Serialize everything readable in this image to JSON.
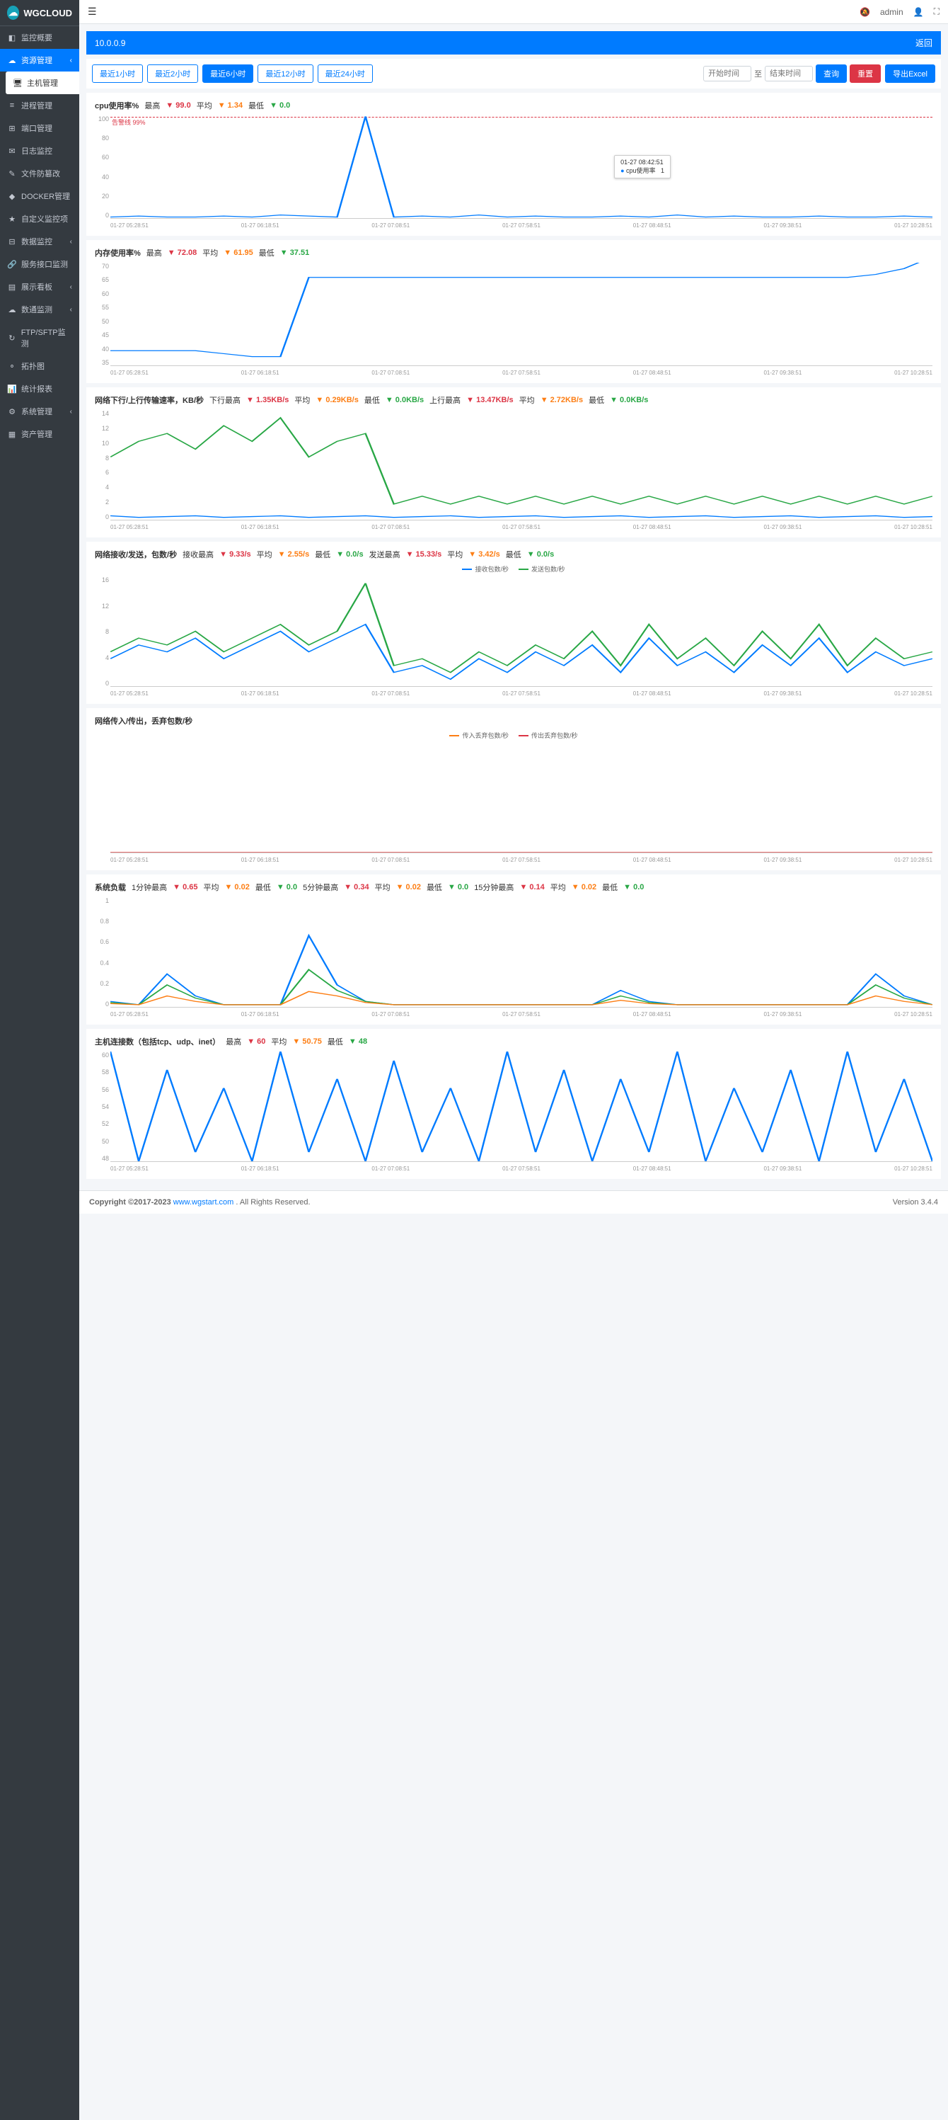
{
  "app": {
    "name": "WGCLOUD"
  },
  "topbar": {
    "user": "admin"
  },
  "sidebar": {
    "items": [
      {
        "icon": "dashboard",
        "label": "监控概要"
      },
      {
        "icon": "cloud",
        "label": "资源管理",
        "active": true,
        "expand": true
      },
      {
        "icon": "desktop",
        "label": "主机管理",
        "sub": true
      },
      {
        "icon": "process",
        "label": "进程管理"
      },
      {
        "icon": "port",
        "label": "端口管理"
      },
      {
        "icon": "log",
        "label": "日志监控"
      },
      {
        "icon": "file",
        "label": "文件防篡改"
      },
      {
        "icon": "docker",
        "label": "DOCKER管理"
      },
      {
        "icon": "star",
        "label": "自定义监控项"
      },
      {
        "icon": "db",
        "label": "数据监控",
        "expand": true
      },
      {
        "icon": "api",
        "label": "服务接口监测"
      },
      {
        "icon": "board",
        "label": "展示看板",
        "expand": true
      },
      {
        "icon": "cloud2",
        "label": "数通监测",
        "expand": true
      },
      {
        "icon": "ftp",
        "label": "FTP/SFTP监测"
      },
      {
        "icon": "topo",
        "label": "拓扑图"
      },
      {
        "icon": "report",
        "label": "统计报表"
      },
      {
        "icon": "sys",
        "label": "系统管理",
        "expand": true
      },
      {
        "icon": "asset",
        "label": "资产管理"
      }
    ]
  },
  "host": {
    "ip": "10.0.0.9",
    "back": "返回"
  },
  "toolbar": {
    "ranges": [
      "最近1小时",
      "最近2小时",
      "最近6小时",
      "最近12小时",
      "最近24小时"
    ],
    "activeRange": 2,
    "startPlaceholder": "开始时间",
    "to": "至",
    "endPlaceholder": "结束时间",
    "query": "查询",
    "reset": "重置",
    "export": "导出Excel"
  },
  "charts": [
    {
      "title": "cpu使用率%",
      "stats": [
        {
          "l": "最高",
          "v": "99.0",
          "c": "red"
        },
        {
          "l": "平均",
          "v": "1.34",
          "c": "orange"
        },
        {
          "l": "最低",
          "v": "0.0",
          "c": "green"
        }
      ],
      "warn": "告警线 99%",
      "tooltip": {
        "time": "01-27 08:42:51",
        "name": "cpu使用率",
        "val": "1"
      },
      "chart_data": {
        "type": "line",
        "ylim": [
          0,
          100
        ],
        "yticks": [
          0,
          20,
          40,
          60,
          80,
          100
        ],
        "x_labels": [
          "01-27 05:28:51",
          "01-27 06:18:51",
          "01-27 07:08:51",
          "01-27 07:58:51",
          "01-27 08:48:51",
          "01-27 09:38:51",
          "01-27 10:28:51"
        ],
        "series": [
          {
            "name": "cpu使用率",
            "color": "#007bff",
            "values": [
              1,
              2,
              1,
              1,
              2,
              1,
              3,
              2,
              1,
              99,
              1,
              2,
              1,
              3,
              1,
              2,
              1,
              1,
              2,
              1,
              3,
              1,
              2,
              1,
              1,
              2,
              1,
              1,
              2,
              1
            ]
          }
        ]
      }
    },
    {
      "title": "内存使用率%",
      "stats": [
        {
          "l": "最高",
          "v": "72.08",
          "c": "red"
        },
        {
          "l": "平均",
          "v": "61.95",
          "c": "orange"
        },
        {
          "l": "最低",
          "v": "37.51",
          "c": "green"
        }
      ],
      "chart_data": {
        "type": "line",
        "ylim": [
          35,
          70
        ],
        "yticks": [
          35,
          40,
          45,
          50,
          55,
          60,
          65,
          70
        ],
        "x_labels": [
          "01-27 05:28:51",
          "01-27 06:18:51",
          "01-27 07:08:51",
          "01-27 07:58:51",
          "01-27 08:48:51",
          "01-27 09:38:51",
          "01-27 10:28:51"
        ],
        "series": [
          {
            "name": "内存使用率",
            "color": "#007bff",
            "values": [
              40,
              40,
              40,
              40,
              39,
              38,
              38,
              65,
              65,
              65,
              65,
              65,
              65,
              65,
              65,
              65,
              65,
              65,
              65,
              65,
              65,
              65,
              65,
              65,
              65,
              65,
              65,
              66,
              68,
              72
            ]
          }
        ]
      }
    },
    {
      "title": "网络下行/上行传输速率，KB/秒",
      "stats": [
        {
          "l": "下行最高",
          "v": "1.35KB/s",
          "c": "red"
        },
        {
          "l": "平均",
          "v": "0.29KB/s",
          "c": "orange"
        },
        {
          "l": "最低",
          "v": "0.0KB/s",
          "c": "green"
        },
        {
          "l": "上行最高",
          "v": "13.47KB/s",
          "c": "red"
        },
        {
          "l": "平均",
          "v": "2.72KB/s",
          "c": "orange"
        },
        {
          "l": "最低",
          "v": "0.0KB/s",
          "c": "green"
        }
      ],
      "chart_data": {
        "type": "line",
        "ylim": [
          0,
          14
        ],
        "yticks": [
          0,
          2,
          4,
          6,
          8,
          10,
          12,
          14
        ],
        "x_labels": [
          "01-27 05:28:51",
          "01-27 06:18:51",
          "01-27 07:08:51",
          "01-27 07:58:51",
          "01-27 08:48:51",
          "01-27 09:38:51",
          "01-27 10:28:51"
        ],
        "series": [
          {
            "name": "下行",
            "color": "#007bff",
            "values": [
              0.5,
              0.3,
              0.4,
              0.5,
              0.3,
              0.4,
              0.5,
              0.3,
              0.4,
              0.5,
              0.3,
              0.4,
              0.5,
              0.3,
              0.4,
              0.5,
              0.3,
              0.4,
              0.5,
              0.3,
              0.4,
              0.5,
              0.3,
              0.4,
              0.5,
              0.3,
              0.4,
              0.5,
              0.3,
              0.4
            ]
          },
          {
            "name": "上行",
            "color": "#28a745",
            "values": [
              8,
              10,
              11,
              9,
              12,
              10,
              13,
              8,
              10,
              11,
              2,
              3,
              2,
              3,
              2,
              3,
              2,
              3,
              2,
              3,
              2,
              3,
              2,
              3,
              2,
              3,
              2,
              3,
              2,
              3
            ]
          }
        ]
      }
    },
    {
      "title": "网络接收/发送，包数/秒",
      "stats": [
        {
          "l": "接收最高",
          "v": "9.33/s",
          "c": "red"
        },
        {
          "l": "平均",
          "v": "2.55/s",
          "c": "orange"
        },
        {
          "l": "最低",
          "v": "0.0/s",
          "c": "green"
        },
        {
          "l": "发送最高",
          "v": "15.33/s",
          "c": "red"
        },
        {
          "l": "平均",
          "v": "3.42/s",
          "c": "orange"
        },
        {
          "l": "最低",
          "v": "0.0/s",
          "c": "green"
        }
      ],
      "legend": [
        {
          "name": "接收包数/秒",
          "color": "#007bff"
        },
        {
          "name": "发送包数/秒",
          "color": "#28a745"
        }
      ],
      "chart_data": {
        "type": "line",
        "ylim": [
          0,
          16
        ],
        "yticks": [
          0,
          4,
          8,
          12,
          16
        ],
        "x_labels": [
          "01-27 05:28:51",
          "01-27 06:18:51",
          "01-27 07:08:51",
          "01-27 07:58:51",
          "01-27 08:48:51",
          "01-27 09:38:51",
          "01-27 10:28:51"
        ],
        "series": [
          {
            "name": "接收包数/秒",
            "color": "#007bff",
            "values": [
              4,
              6,
              5,
              7,
              4,
              6,
              8,
              5,
              7,
              9,
              2,
              3,
              1,
              4,
              2,
              5,
              3,
              6,
              2,
              7,
              3,
              5,
              2,
              6,
              3,
              7,
              2,
              5,
              3,
              4
            ]
          },
          {
            "name": "发送包数/秒",
            "color": "#28a745",
            "values": [
              5,
              7,
              6,
              8,
              5,
              7,
              9,
              6,
              8,
              15,
              3,
              4,
              2,
              5,
              3,
              6,
              4,
              8,
              3,
              9,
              4,
              7,
              3,
              8,
              4,
              9,
              3,
              7,
              4,
              5
            ]
          }
        ]
      }
    },
    {
      "title": "网络传入/传出，丢弃包数/秒",
      "legend": [
        {
          "name": "传入丢弃包数/秒",
          "color": "#fd7e14"
        },
        {
          "name": "传出丢弃包数/秒",
          "color": "#dc3545"
        }
      ],
      "chart_data": {
        "type": "line",
        "ylim": [
          0,
          1
        ],
        "yticks": [],
        "x_labels": [
          "01-27 05:28:51",
          "01-27 06:18:51",
          "01-27 07:08:51",
          "01-27 07:58:51",
          "01-27 08:48:51",
          "01-27 09:38:51",
          "01-27 10:28:51"
        ],
        "series": [
          {
            "name": "传入丢弃包数/秒",
            "color": "#fd7e14",
            "values": [
              0,
              0,
              0,
              0,
              0,
              0,
              0,
              0,
              0,
              0,
              0,
              0,
              0,
              0,
              0,
              0,
              0,
              0,
              0,
              0,
              0,
              0,
              0,
              0,
              0,
              0,
              0,
              0,
              0,
              0
            ]
          },
          {
            "name": "传出丢弃包数/秒",
            "color": "#dc3545",
            "values": [
              0,
              0,
              0,
              0,
              0,
              0,
              0,
              0,
              0,
              0,
              0,
              0,
              0,
              0,
              0,
              0,
              0,
              0,
              0,
              0,
              0,
              0,
              0,
              0,
              0,
              0,
              0,
              0,
              0,
              0
            ]
          }
        ]
      }
    },
    {
      "title": "系统负载",
      "stats": [
        {
          "l": "1分钟最高",
          "v": "0.65",
          "c": "red"
        },
        {
          "l": "平均",
          "v": "0.02",
          "c": "orange"
        },
        {
          "l": "最低",
          "v": "0.0",
          "c": "green"
        },
        {
          "l": "5分钟最高",
          "v": "0.34",
          "c": "red"
        },
        {
          "l": "平均",
          "v": "0.02",
          "c": "orange"
        },
        {
          "l": "最低",
          "v": "0.0",
          "c": "green"
        },
        {
          "l": "15分钟最高",
          "v": "0.14",
          "c": "red"
        },
        {
          "l": "平均",
          "v": "0.02",
          "c": "orange"
        },
        {
          "l": "最低",
          "v": "0.0",
          "c": "green"
        }
      ],
      "chart_data": {
        "type": "line",
        "ylim": [
          0,
          1
        ],
        "yticks": [
          0,
          0.2,
          0.4,
          0.6,
          0.8,
          1
        ],
        "x_labels": [
          "01-27 05:28:51",
          "01-27 06:18:51",
          "01-27 07:08:51",
          "01-27 07:58:51",
          "01-27 08:48:51",
          "01-27 09:38:51",
          "01-27 10:28:51"
        ],
        "series": [
          {
            "name": "1分钟",
            "color": "#007bff",
            "values": [
              0.05,
              0.02,
              0.3,
              0.1,
              0.02,
              0.02,
              0.02,
              0.65,
              0.2,
              0.05,
              0.02,
              0.02,
              0.02,
              0.02,
              0.02,
              0.02,
              0.02,
              0.02,
              0.15,
              0.05,
              0.02,
              0.02,
              0.02,
              0.02,
              0.02,
              0.02,
              0.02,
              0.3,
              0.1,
              0.02
            ]
          },
          {
            "name": "5分钟",
            "color": "#28a745",
            "values": [
              0.04,
              0.02,
              0.2,
              0.08,
              0.02,
              0.02,
              0.02,
              0.34,
              0.15,
              0.05,
              0.02,
              0.02,
              0.02,
              0.02,
              0.02,
              0.02,
              0.02,
              0.02,
              0.1,
              0.04,
              0.02,
              0.02,
              0.02,
              0.02,
              0.02,
              0.02,
              0.02,
              0.2,
              0.08,
              0.02
            ]
          },
          {
            "name": "15分钟",
            "color": "#fd7e14",
            "values": [
              0.03,
              0.02,
              0.1,
              0.05,
              0.02,
              0.02,
              0.02,
              0.14,
              0.1,
              0.04,
              0.02,
              0.02,
              0.02,
              0.02,
              0.02,
              0.02,
              0.02,
              0.02,
              0.06,
              0.03,
              0.02,
              0.02,
              0.02,
              0.02,
              0.02,
              0.02,
              0.02,
              0.1,
              0.05,
              0.02
            ]
          }
        ]
      }
    },
    {
      "title": "主机连接数（包括tcp、udp、inet）",
      "stats": [
        {
          "l": "最高",
          "v": "60",
          "c": "red"
        },
        {
          "l": "平均",
          "v": "50.75",
          "c": "orange"
        },
        {
          "l": "最低",
          "v": "48",
          "c": "green"
        }
      ],
      "chart_data": {
        "type": "line",
        "ylim": [
          48,
          60
        ],
        "yticks": [
          48,
          50,
          52,
          54,
          56,
          58,
          60
        ],
        "x_labels": [
          "01-27 05:28:51",
          "01-27 06:18:51",
          "01-27 07:08:51",
          "01-27 07:58:51",
          "01-27 08:48:51",
          "01-27 09:38:51",
          "01-27 10:28:51"
        ],
        "series": [
          {
            "name": "连接数",
            "color": "#007bff",
            "values": [
              60,
              48,
              58,
              49,
              56,
              48,
              60,
              49,
              57,
              48,
              59,
              49,
              56,
              48,
              60,
              49,
              58,
              48,
              57,
              49,
              60,
              48,
              56,
              49,
              58,
              48,
              60,
              49,
              57,
              48
            ]
          }
        ]
      }
    }
  ],
  "footer": {
    "copyright": "Copyright ©2017-2023 ",
    "link": "www.wgstart.com",
    "rights": ". All Rights Reserved.",
    "version": "Version 3.4.4"
  }
}
